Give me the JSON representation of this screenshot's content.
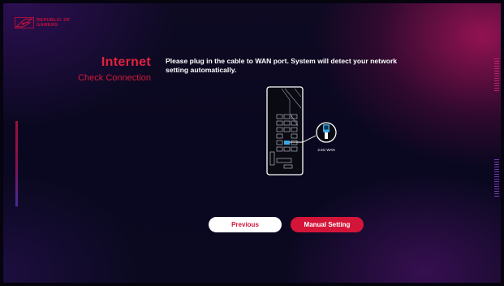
{
  "brand": {
    "line1": "REPUBLIC OF",
    "line2": "GAMERS"
  },
  "step": {
    "title": "Internet",
    "subtitle": "Check Connection"
  },
  "instruction": "Please plug in the cable to WAN port. System will detect your network setting automatically.",
  "illustration": {
    "port_label": "2.5G WAN"
  },
  "buttons": {
    "previous": "Previous",
    "manual_setting": "Manual Setting"
  },
  "colors": {
    "accent": "#d4153a",
    "background": "#0b0920",
    "highlight_port": "#3aa8e8"
  }
}
